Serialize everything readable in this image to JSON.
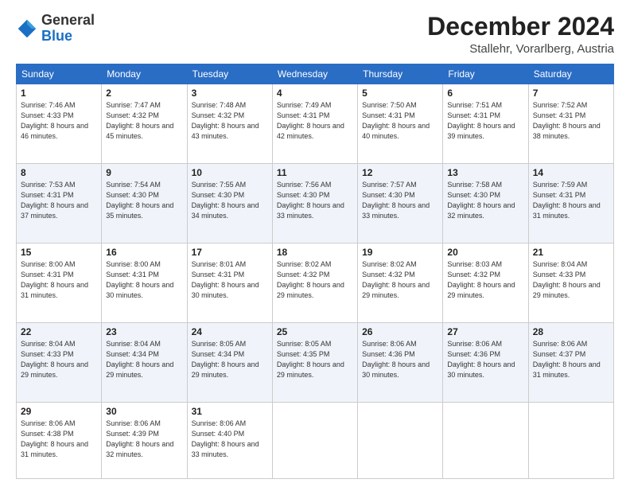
{
  "logo": {
    "general": "General",
    "blue": "Blue"
  },
  "header": {
    "month": "December 2024",
    "location": "Stallehr, Vorarlberg, Austria"
  },
  "weekdays": [
    "Sunday",
    "Monday",
    "Tuesday",
    "Wednesday",
    "Thursday",
    "Friday",
    "Saturday"
  ],
  "weeks": [
    [
      {
        "day": "1",
        "sunrise": "Sunrise: 7:46 AM",
        "sunset": "Sunset: 4:33 PM",
        "daylight": "Daylight: 8 hours and 46 minutes."
      },
      {
        "day": "2",
        "sunrise": "Sunrise: 7:47 AM",
        "sunset": "Sunset: 4:32 PM",
        "daylight": "Daylight: 8 hours and 45 minutes."
      },
      {
        "day": "3",
        "sunrise": "Sunrise: 7:48 AM",
        "sunset": "Sunset: 4:32 PM",
        "daylight": "Daylight: 8 hours and 43 minutes."
      },
      {
        "day": "4",
        "sunrise": "Sunrise: 7:49 AM",
        "sunset": "Sunset: 4:31 PM",
        "daylight": "Daylight: 8 hours and 42 minutes."
      },
      {
        "day": "5",
        "sunrise": "Sunrise: 7:50 AM",
        "sunset": "Sunset: 4:31 PM",
        "daylight": "Daylight: 8 hours and 40 minutes."
      },
      {
        "day": "6",
        "sunrise": "Sunrise: 7:51 AM",
        "sunset": "Sunset: 4:31 PM",
        "daylight": "Daylight: 8 hours and 39 minutes."
      },
      {
        "day": "7",
        "sunrise": "Sunrise: 7:52 AM",
        "sunset": "Sunset: 4:31 PM",
        "daylight": "Daylight: 8 hours and 38 minutes."
      }
    ],
    [
      {
        "day": "8",
        "sunrise": "Sunrise: 7:53 AM",
        "sunset": "Sunset: 4:31 PM",
        "daylight": "Daylight: 8 hours and 37 minutes."
      },
      {
        "day": "9",
        "sunrise": "Sunrise: 7:54 AM",
        "sunset": "Sunset: 4:30 PM",
        "daylight": "Daylight: 8 hours and 35 minutes."
      },
      {
        "day": "10",
        "sunrise": "Sunrise: 7:55 AM",
        "sunset": "Sunset: 4:30 PM",
        "daylight": "Daylight: 8 hours and 34 minutes."
      },
      {
        "day": "11",
        "sunrise": "Sunrise: 7:56 AM",
        "sunset": "Sunset: 4:30 PM",
        "daylight": "Daylight: 8 hours and 33 minutes."
      },
      {
        "day": "12",
        "sunrise": "Sunrise: 7:57 AM",
        "sunset": "Sunset: 4:30 PM",
        "daylight": "Daylight: 8 hours and 33 minutes."
      },
      {
        "day": "13",
        "sunrise": "Sunrise: 7:58 AM",
        "sunset": "Sunset: 4:30 PM",
        "daylight": "Daylight: 8 hours and 32 minutes."
      },
      {
        "day": "14",
        "sunrise": "Sunrise: 7:59 AM",
        "sunset": "Sunset: 4:31 PM",
        "daylight": "Daylight: 8 hours and 31 minutes."
      }
    ],
    [
      {
        "day": "15",
        "sunrise": "Sunrise: 8:00 AM",
        "sunset": "Sunset: 4:31 PM",
        "daylight": "Daylight: 8 hours and 31 minutes."
      },
      {
        "day": "16",
        "sunrise": "Sunrise: 8:00 AM",
        "sunset": "Sunset: 4:31 PM",
        "daylight": "Daylight: 8 hours and 30 minutes."
      },
      {
        "day": "17",
        "sunrise": "Sunrise: 8:01 AM",
        "sunset": "Sunset: 4:31 PM",
        "daylight": "Daylight: 8 hours and 30 minutes."
      },
      {
        "day": "18",
        "sunrise": "Sunrise: 8:02 AM",
        "sunset": "Sunset: 4:32 PM",
        "daylight": "Daylight: 8 hours and 29 minutes."
      },
      {
        "day": "19",
        "sunrise": "Sunrise: 8:02 AM",
        "sunset": "Sunset: 4:32 PM",
        "daylight": "Daylight: 8 hours and 29 minutes."
      },
      {
        "day": "20",
        "sunrise": "Sunrise: 8:03 AM",
        "sunset": "Sunset: 4:32 PM",
        "daylight": "Daylight: 8 hours and 29 minutes."
      },
      {
        "day": "21",
        "sunrise": "Sunrise: 8:04 AM",
        "sunset": "Sunset: 4:33 PM",
        "daylight": "Daylight: 8 hours and 29 minutes."
      }
    ],
    [
      {
        "day": "22",
        "sunrise": "Sunrise: 8:04 AM",
        "sunset": "Sunset: 4:33 PM",
        "daylight": "Daylight: 8 hours and 29 minutes."
      },
      {
        "day": "23",
        "sunrise": "Sunrise: 8:04 AM",
        "sunset": "Sunset: 4:34 PM",
        "daylight": "Daylight: 8 hours and 29 minutes."
      },
      {
        "day": "24",
        "sunrise": "Sunrise: 8:05 AM",
        "sunset": "Sunset: 4:34 PM",
        "daylight": "Daylight: 8 hours and 29 minutes."
      },
      {
        "day": "25",
        "sunrise": "Sunrise: 8:05 AM",
        "sunset": "Sunset: 4:35 PM",
        "daylight": "Daylight: 8 hours and 29 minutes."
      },
      {
        "day": "26",
        "sunrise": "Sunrise: 8:06 AM",
        "sunset": "Sunset: 4:36 PM",
        "daylight": "Daylight: 8 hours and 30 minutes."
      },
      {
        "day": "27",
        "sunrise": "Sunrise: 8:06 AM",
        "sunset": "Sunset: 4:36 PM",
        "daylight": "Daylight: 8 hours and 30 minutes."
      },
      {
        "day": "28",
        "sunrise": "Sunrise: 8:06 AM",
        "sunset": "Sunset: 4:37 PM",
        "daylight": "Daylight: 8 hours and 31 minutes."
      }
    ],
    [
      {
        "day": "29",
        "sunrise": "Sunrise: 8:06 AM",
        "sunset": "Sunset: 4:38 PM",
        "daylight": "Daylight: 8 hours and 31 minutes."
      },
      {
        "day": "30",
        "sunrise": "Sunrise: 8:06 AM",
        "sunset": "Sunset: 4:39 PM",
        "daylight": "Daylight: 8 hours and 32 minutes."
      },
      {
        "day": "31",
        "sunrise": "Sunrise: 8:06 AM",
        "sunset": "Sunset: 4:40 PM",
        "daylight": "Daylight: 8 hours and 33 minutes."
      },
      null,
      null,
      null,
      null
    ]
  ]
}
